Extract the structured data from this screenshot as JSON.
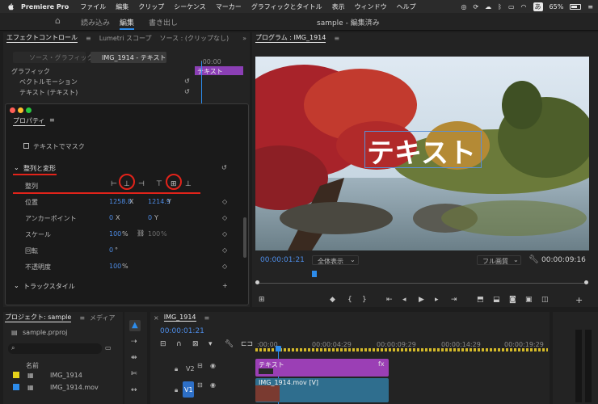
{
  "menubar": {
    "app_name": "Premiere Pro",
    "items": [
      "ファイル",
      "編集",
      "クリップ",
      "シーケンス",
      "マーカー",
      "グラフィックとタイトル",
      "表示",
      "ウィンドウ",
      "ヘルプ"
    ],
    "battery": "65%",
    "input_mode": "あ"
  },
  "workspace": {
    "home_icon": "home-icon",
    "tabs": [
      "読み込み",
      "編集",
      "書き出し"
    ],
    "active_tab": "編集",
    "document_title": "sample - 編集済み"
  },
  "effect_controls": {
    "tabs": [
      "エフェクトコントロール",
      "Lumetri スコープ",
      "ソース : (クリップなし)"
    ],
    "source_label": "ソース・グラフィック",
    "clip_label": "IMG_1914 - テキスト",
    "timeline_time": ":00:00",
    "clip_block_label": "テキスト",
    "rows": [
      "グラフィック",
      "ベクトルモーション",
      "テキスト (テキスト)"
    ]
  },
  "properties": {
    "title": "プロパティ",
    "mask_label": "テキストでマスク",
    "section_label": "整列と変形",
    "align_label": "整列",
    "position_label": "位置",
    "position_x": "1258.8",
    "position_x_unit": "X",
    "position_y": "1214.9",
    "position_y_unit": "Y",
    "anchor_label": "アンカーポイント",
    "anchor_x": "0",
    "anchor_x_unit": "X",
    "anchor_y": "0",
    "anchor_y_unit": "Y",
    "scale_label": "スケール",
    "scale_value": "100",
    "scale_unit": "%",
    "scale_value2": "100",
    "scale_unit2": "%",
    "rotation_label": "回転",
    "rotation_value": "0",
    "rotation_unit": "°",
    "opacity_label": "不透明度",
    "opacity_value": "100",
    "opacity_unit": "%",
    "next_section": "トラックスタイル"
  },
  "program": {
    "tab_label": "プログラム : IMG_1914",
    "overlay_text": "テキスト",
    "timecode": "00:00:01:21",
    "zoom": "全体表示",
    "quality": "フル画質",
    "duration": "00:00:09:16"
  },
  "project": {
    "tab_label": "プロジェクト: sample",
    "tab2_label": "メディア",
    "file": "sample.prproj",
    "column_name": "名前",
    "items": [
      {
        "name": "IMG_1914",
        "color": "#e6d21a"
      },
      {
        "name": "IMG_1914.mov",
        "color": "#2d8ceb"
      }
    ]
  },
  "timeline": {
    "tab_label": "IMG_1914",
    "timecode": "00:00:01:21",
    "ruler": [
      ":00:00",
      "00:00:04:29",
      "00:00:09:29",
      "00:00:14:29",
      "00:00:19:29"
    ],
    "tracks": [
      {
        "name": "V2",
        "clip": "テキスト",
        "clip_color": "#9b3fb5"
      },
      {
        "name": "V1",
        "clip": "IMG_1914.mov [V]",
        "clip_color": "#2f6e8e"
      }
    ],
    "fx_label": "fx"
  }
}
